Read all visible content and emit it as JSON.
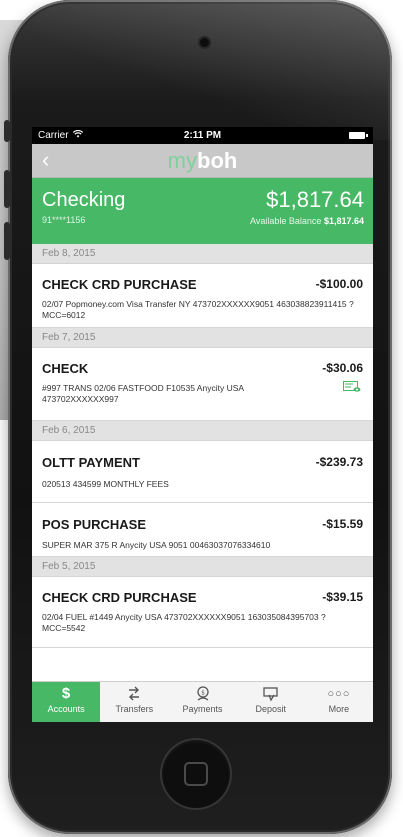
{
  "status_bar": {
    "carrier": "Carrier",
    "time": "2:11 PM"
  },
  "nav": {
    "logo_my": "my",
    "logo_boh": "boh"
  },
  "account": {
    "name": "Checking",
    "number": "91****1156",
    "balance": "$1,817.64",
    "available_label": "Available Balance",
    "available_amount": "$1,817.64"
  },
  "transactions": {
    "d1": "Feb 8, 2015",
    "t1": {
      "title": "CHECK CRD PURCHASE",
      "amount": "-$100.00",
      "desc": "02/07 Popmoney.com Visa Transfer NY 473702XXXXXX9051 463038823911415 ?MCC=6012"
    },
    "d2": "Feb 7, 2015",
    "t2": {
      "title": "CHECK",
      "amount": "-$30.06",
      "desc": "#997 TRANS 02/06 FASTFOOD F10535 Anycity USA 473702XXXXXX997"
    },
    "d3": "Feb 6, 2015",
    "t3": {
      "title": "OLTT PAYMENT",
      "amount": "-$239.73",
      "desc": "020513 434599 MONTHLY FEES"
    },
    "t4": {
      "title": "POS PURCHASE",
      "amount": "-$15.59",
      "desc": "SUPER MAR 375 R Anycity USA 9051 00463037076334610"
    },
    "d4": "Feb 5, 2015",
    "t5": {
      "title": "CHECK CRD PURCHASE",
      "amount": "-$39.15",
      "desc": "02/04 FUEL #1449 Anycity USA 473702XXXXXX9051 163035084395703 ?MCC=5542"
    }
  },
  "tabs": {
    "accounts": "Accounts",
    "transfers": "Transfers",
    "payments": "Payments",
    "deposit": "Deposit",
    "more": "More"
  },
  "colors": {
    "accent": "#47b966",
    "nav_bg": "#c8c8c8"
  },
  "icons": [
    "back-chevron-icon",
    "wifi-icon",
    "battery-icon",
    "check-image-icon",
    "dollar-icon",
    "transfer-icon",
    "payments-icon",
    "deposit-icon",
    "more-dots-icon"
  ]
}
